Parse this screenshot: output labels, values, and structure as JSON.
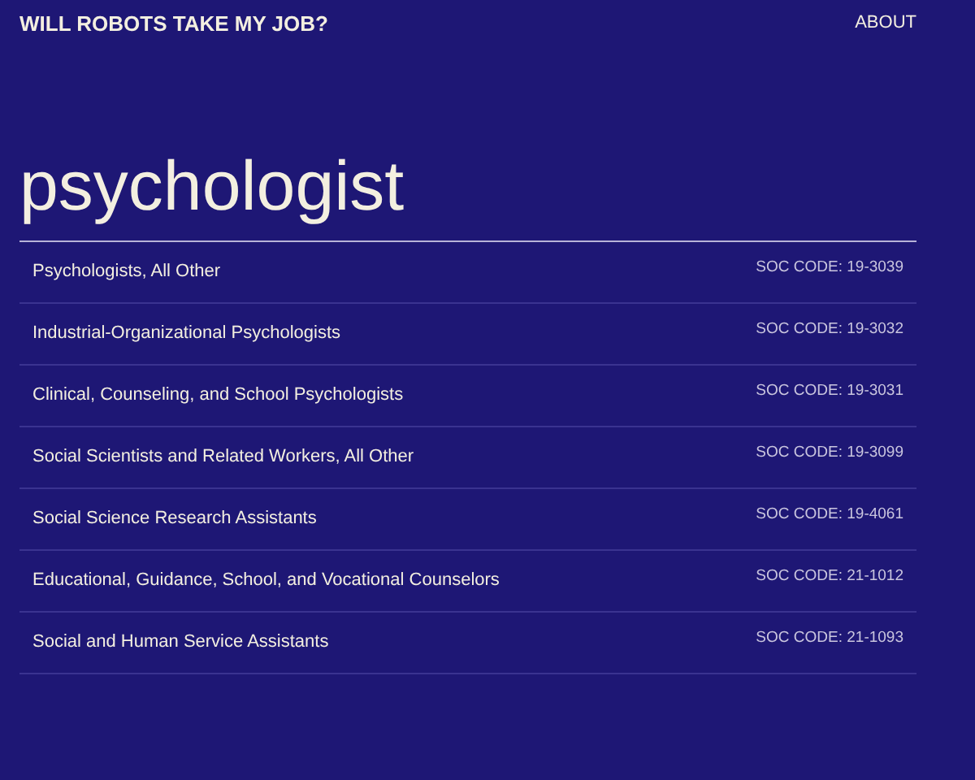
{
  "header": {
    "title": "WILL ROBOTS TAKE MY JOB?",
    "nav": [
      "ABOUT"
    ]
  },
  "search": {
    "value": "psychologist"
  },
  "results": [
    {
      "name": "Psychologists, All Other",
      "code": "SOC CODE: 19-3039"
    },
    {
      "name": "Industrial-Organizational Psychologists",
      "code": "SOC CODE: 19-3032"
    },
    {
      "name": "Clinical, Counseling, and School Psychologists",
      "code": "SOC CODE: 19-3031"
    },
    {
      "name": "Social Scientists and Related Workers, All Other",
      "code": "SOC CODE: 19-3099"
    },
    {
      "name": "Social Science Research Assistants",
      "code": "SOC CODE: 19-4061"
    },
    {
      "name": "Educational, Guidance, School, and Vocational Counselors",
      "code": "SOC CODE: 21-1012"
    },
    {
      "name": "Social and Human Service Assistants",
      "code": "SOC CODE: 21-1093"
    }
  ]
}
